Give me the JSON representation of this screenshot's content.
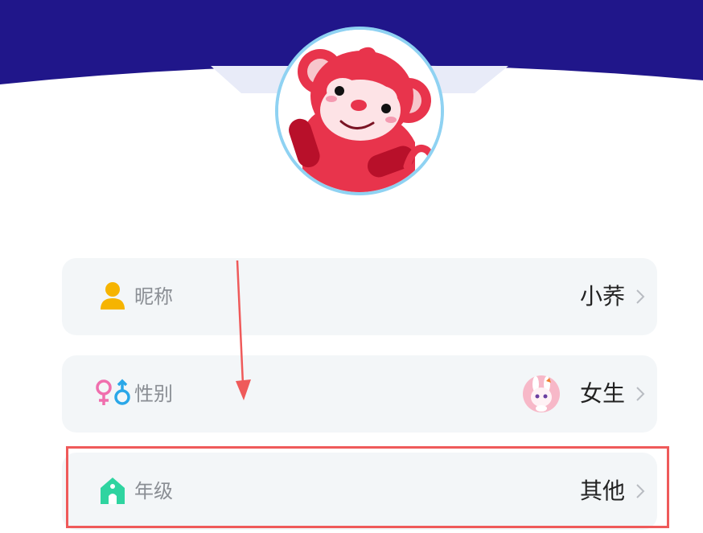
{
  "profile": {
    "avatar_icon": "monkey-avatar"
  },
  "rows": {
    "nickname": {
      "label": "昵称",
      "value": "小荞",
      "icon": "person-icon"
    },
    "gender": {
      "label": "性别",
      "value": "女生",
      "icon": "gender-icon",
      "avatar_icon": "bunny-girl-avatar"
    },
    "grade": {
      "label": "年级",
      "value": "其他",
      "icon": "school-icon"
    }
  },
  "colors": {
    "header_navy": "#20168a",
    "row_bg": "#f3f6f8",
    "highlight_red": "#ef5a5a",
    "avatar_ring": "#8fd2f2"
  }
}
